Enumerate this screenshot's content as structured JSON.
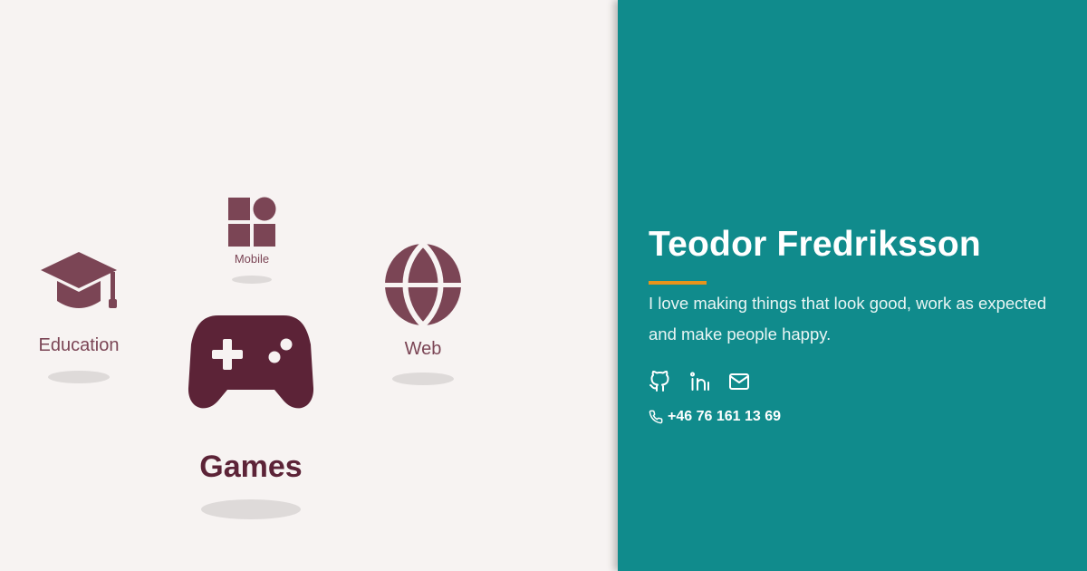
{
  "categories": {
    "education": {
      "label": "Education",
      "icon": "graduation-cap-icon"
    },
    "mobile": {
      "label": "Mobile",
      "icon": "mobile-apps-icon"
    },
    "web": {
      "label": "Web",
      "icon": "globe-icon"
    },
    "games": {
      "label": "Games",
      "icon": "gamepad-icon"
    }
  },
  "profile": {
    "name": "Teodor Fredriksson",
    "bio": "I love making things that look good, work as expected and make people happy.",
    "phone": "+46 76 161 13 69"
  },
  "social": [
    {
      "icon": "github-icon"
    },
    {
      "icon": "linkedin-icon"
    },
    {
      "icon": "mail-icon"
    }
  ],
  "colors": {
    "panel": "#108b8c",
    "background": "#f7f3f2",
    "accent": "#e8941c",
    "icon_muted": "#7b4555",
    "icon_dark": "#5c2337"
  }
}
